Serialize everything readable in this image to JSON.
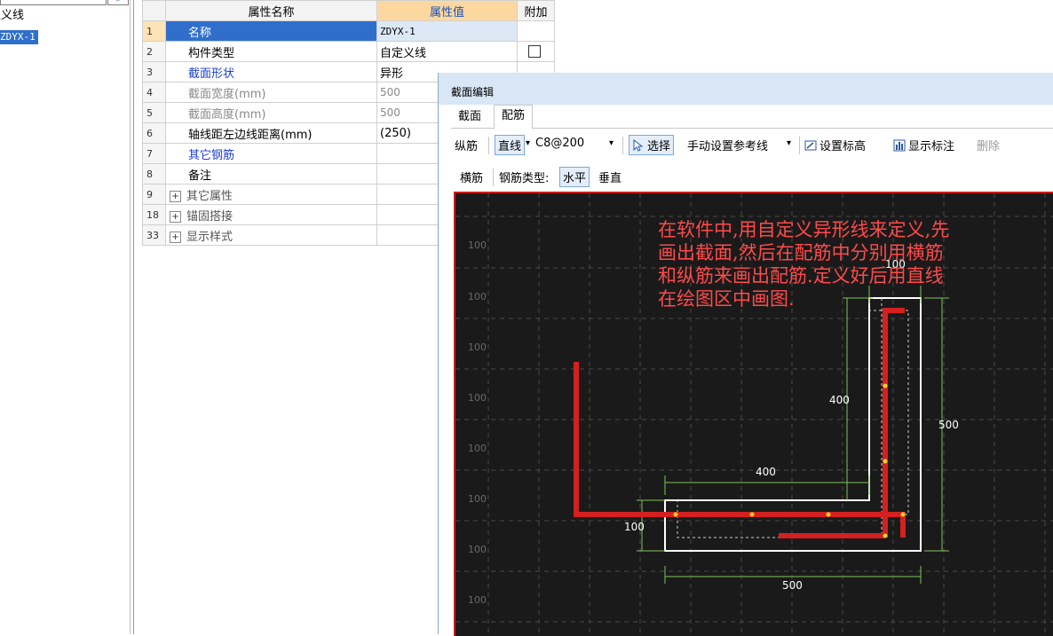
{
  "tree": {
    "node_label": "定义线",
    "selected_item": "ZDYX-1"
  },
  "grid": {
    "header": {
      "name_col": "属性名称",
      "value_col": "属性值",
      "extra_col": "附加"
    },
    "rows": [
      {
        "num": "1",
        "name": "名称",
        "value": "ZDYX-1",
        "style": "sel"
      },
      {
        "num": "2",
        "name": "构件类型",
        "value": "自定义线",
        "style": "normal"
      },
      {
        "num": "3",
        "name": "截面形状",
        "value": "异形",
        "style": "blue"
      },
      {
        "num": "4",
        "name": "截面宽度(mm)",
        "value": "500",
        "style": "gray"
      },
      {
        "num": "5",
        "name": "截面高度(mm)",
        "value": "500",
        "style": "gray"
      },
      {
        "num": "6",
        "name": "轴线距左边线距离(mm)",
        "value": "(250)",
        "style": "normal"
      },
      {
        "num": "7",
        "name": "其它钢筋",
        "value": "",
        "style": "blue"
      },
      {
        "num": "8",
        "name": "备注",
        "value": "",
        "style": "normal"
      },
      {
        "num": "9",
        "name": "其它属性",
        "value": "",
        "style": "grp"
      },
      {
        "num": "18",
        "name": "锚固搭接",
        "value": "",
        "style": "grp"
      },
      {
        "num": "33",
        "name": "显示样式",
        "value": "",
        "style": "grp"
      }
    ]
  },
  "editor": {
    "title": "截面编辑",
    "tabs": [
      "截面",
      "配筋"
    ],
    "toolbar1": {
      "longitudinal": "纵筋",
      "line": "直线",
      "rebar_spec": "C8@200",
      "select": "选择",
      "manual_ref": "手动设置参考线",
      "set_elevation": "设置标高",
      "show_label": "显示标注",
      "delete": "删除"
    },
    "toolbar2": {
      "transverse": "横筋",
      "rebar_type": "钢筋类型:",
      "horizontal": "水平",
      "vertical": "垂直"
    },
    "canvas": {
      "annotation_lines": [
        "在软件中,用自定义异形线来定义,先",
        "画出截面,然后在配筋中分别用横筋",
        "和纵筋来画出配筋.定义好后用直线",
        "在绘图区中画图."
      ],
      "grid_labels": [
        "100",
        "100",
        "100",
        "100",
        "100",
        "100",
        "100",
        "100"
      ],
      "dims": {
        "top_width": "100",
        "left_height": "400",
        "total_height": "500",
        "arm_length": "400",
        "bottom_thickness": "100",
        "total_width": "500"
      },
      "colors": {
        "rebar": "#d42020",
        "outline": "#ffffff",
        "dimension": "#7fc65a",
        "annotation": "#ff4a4a"
      }
    }
  }
}
